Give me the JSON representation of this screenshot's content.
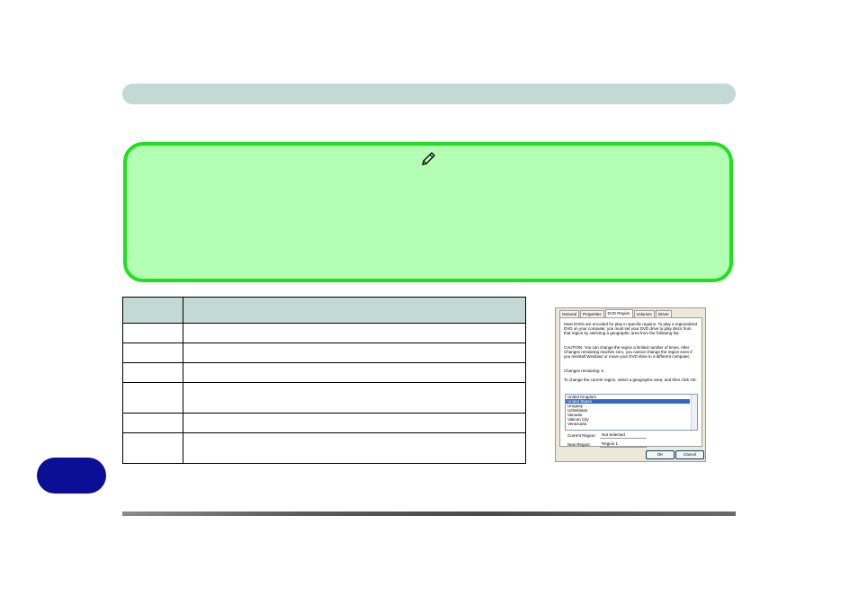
{
  "table": {
    "header": [
      "",
      ""
    ],
    "rows": [
      [
        "",
        ""
      ],
      [
        "",
        ""
      ],
      [
        "",
        ""
      ],
      [
        "",
        ""
      ],
      [
        "",
        ""
      ],
      [
        "",
        ""
      ]
    ]
  },
  "dialog": {
    "tabs": [
      "General",
      "Properties",
      "DVD Region",
      "Volumes",
      "Driver"
    ],
    "intro": "Most DVDs are encoded for play in specific regions. To play a regionalized DVD on your computer, you must set your DVD drive to play discs from that region by selecting a geographic area from the following list.",
    "caution": "CAUTION:  You can change the region a limited number of times. After Changes remaining reaches zero, you cannot change the region even if you reinstall Windows or move your DVD drive to a different computer.",
    "changes_remaining": "Changes remaining: 5",
    "instruction": "To change the current region, select a geographic area, and then click OK.",
    "list_items": [
      "United Kingdom",
      "United States",
      "Uruguay",
      "Uzbekistan",
      "Vanuatu",
      "Vatican City",
      "Venezuela"
    ],
    "current_region_label": "Current Region:",
    "current_region_value": "Not Selected",
    "new_region_label": "New Region:",
    "new_region_value": "Region 1",
    "ok_label": "OK",
    "cancel_label": "Cancel"
  }
}
